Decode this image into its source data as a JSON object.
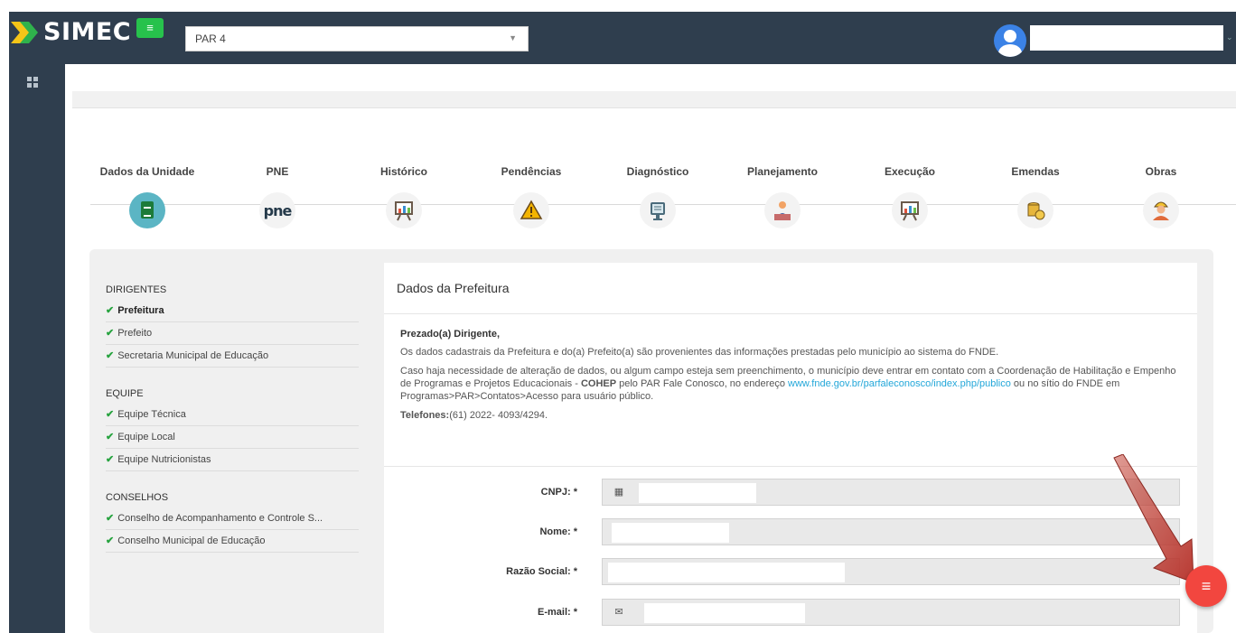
{
  "header": {
    "logo_text": "SIMEC",
    "system_select_value": "PAR 4",
    "menu_icon": "list-icon",
    "avatar_icon": "user-avatar-icon"
  },
  "steps": [
    {
      "label": "Dados da Unidade",
      "icon": "document-icon"
    },
    {
      "label": "PNE",
      "icon": "pne-logo",
      "text": "pne"
    },
    {
      "label": "Histórico",
      "icon": "presentation-chart-icon"
    },
    {
      "label": "Pendências",
      "icon": "warning-icon"
    },
    {
      "label": "Diagnóstico",
      "icon": "monitor-icon"
    },
    {
      "label": "Planejamento",
      "icon": "planning-icon"
    },
    {
      "label": "Execução",
      "icon": "presentation-chart-icon"
    },
    {
      "label": "Emendas",
      "icon": "coins-icon"
    },
    {
      "label": "Obras",
      "icon": "worker-icon"
    }
  ],
  "left_nav": {
    "groups": [
      {
        "title": "DIRIGENTES",
        "items": [
          "Prefeitura",
          "Prefeito",
          "Secretaria Municipal de Educação"
        ]
      },
      {
        "title": "EQUIPE",
        "items": [
          "Equipe Técnica",
          "Equipe Local",
          "Equipe Nutricionistas"
        ]
      },
      {
        "title": "CONSELHOS",
        "items": [
          "Conselho de Acompanhamento e Controle S...",
          "Conselho Municipal de Educação"
        ]
      }
    ]
  },
  "card": {
    "title": "Dados da Prefeitura",
    "greeting": "Prezado(a) Dirigente,",
    "paragraph1": "Os dados cadastrais da Prefeitura e do(a) Prefeito(a) são provenientes das informações prestadas pelo município ao sistema do FNDE.",
    "paragraph2_a": "Caso haja necessidade de alteração de dados, ou algum campo esteja sem preenchimento, o município deve entrar em contato com a Coordenação de Habilitação e Empenho de Programas e Projetos Educacionais - ",
    "paragraph2_bold": "COHEP",
    "paragraph2_b": " pelo PAR Fale Conosco, no endereço ",
    "link": "www.fnde.gov.br/parfaleconosco/index.php/publico",
    "paragraph2_c": " ou no sítio do FNDE em Programas>PAR>Contatos>Acesso para usuário público.",
    "phones_label": "Telefones:",
    "phones_value": "(61) 2022- 4093/4294."
  },
  "form": {
    "cnpj_label": "CNPJ: *",
    "nome_label": "Nome: *",
    "razao_label": "Razão Social: *",
    "email_label": "E-mail: *",
    "cnpj_icon": "building-icon",
    "email_icon": "envelope-icon"
  },
  "fab_icon": "list-icon",
  "colors": {
    "navbar": "#2f3e4e",
    "menu_button": "#27c24c",
    "active_step": "#5bb5c4",
    "check": "#27a33f",
    "link": "#23a7d9",
    "fab": "#f2463f"
  }
}
